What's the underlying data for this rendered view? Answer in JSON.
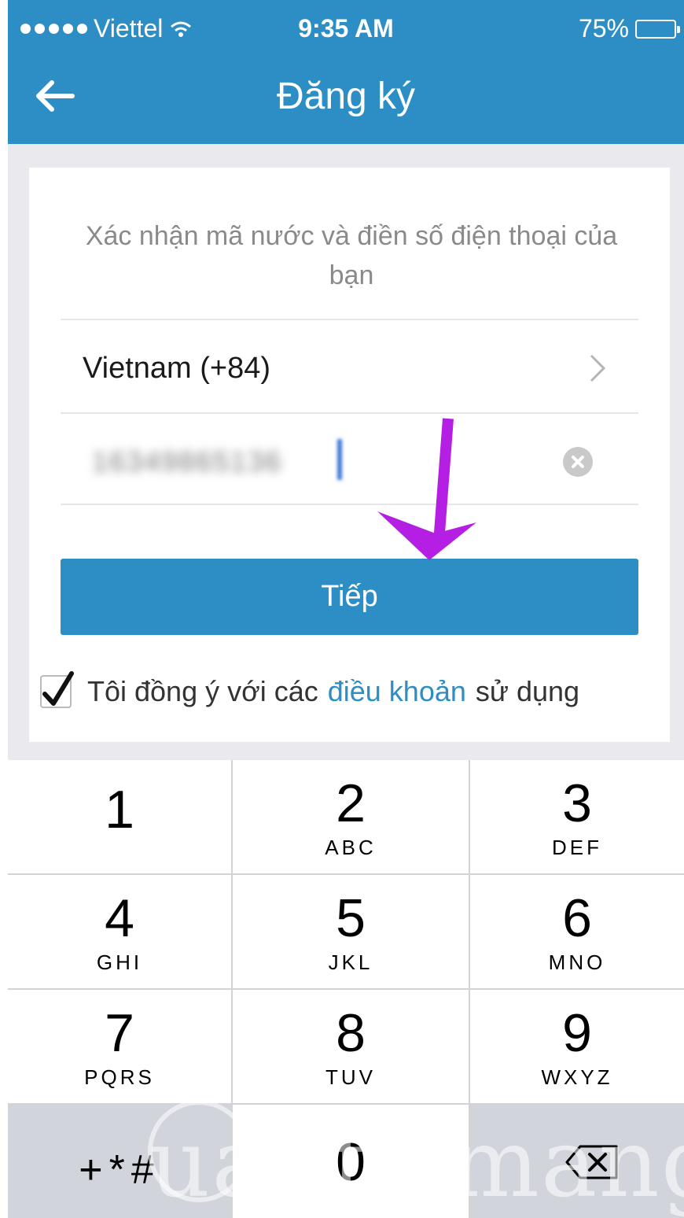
{
  "status_bar": {
    "carrier": "Viettel",
    "time": "9:35 AM",
    "battery": "75%",
    "battery_level": 0.75
  },
  "header": {
    "title": "Đăng ký",
    "back_icon": "arrow-left-icon"
  },
  "form": {
    "prompt": "Xác nhận mã nước và điền số điện thoại của bạn",
    "country": "Vietnam (+84)",
    "phone_value": "1634986513​6",
    "next_label": "Tiếp",
    "agree_prefix": "Tôi đồng ý với các",
    "agree_link": "điều khoản",
    "agree_suffix": "sử dụng",
    "agree_checked": true
  },
  "keypad": {
    "keys": [
      {
        "num": "1",
        "letters": ""
      },
      {
        "num": "2",
        "letters": "ABC"
      },
      {
        "num": "3",
        "letters": "DEF"
      },
      {
        "num": "4",
        "letters": "GHI"
      },
      {
        "num": "5",
        "letters": "JKL"
      },
      {
        "num": "6",
        "letters": "MNO"
      },
      {
        "num": "7",
        "letters": "PQRS"
      },
      {
        "num": "8",
        "letters": "TUV"
      },
      {
        "num": "9",
        "letters": "WXYZ"
      },
      {
        "num": "+*#",
        "letters": ""
      },
      {
        "num": "0",
        "letters": ""
      }
    ]
  },
  "colors": {
    "accent": "#2c8ec4",
    "annotation_arrow": "#b51fe3"
  },
  "watermark": "Quantrimang"
}
